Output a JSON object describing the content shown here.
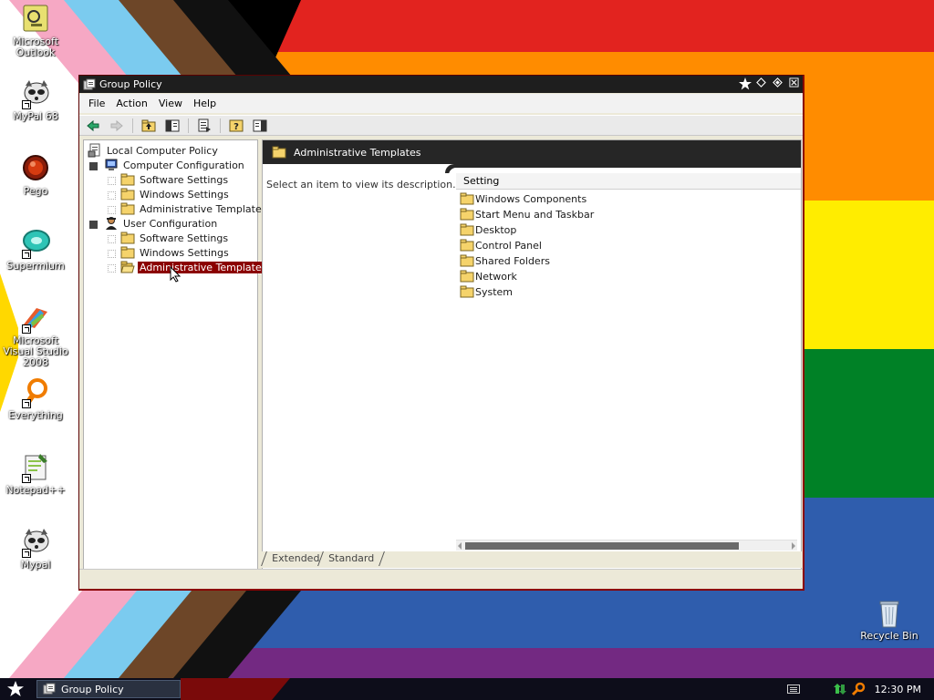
{
  "desktop": {
    "icons": [
      {
        "label": "Microsoft Outlook",
        "icon": "outlook-icon"
      },
      {
        "label": "MyPal 68",
        "icon": "mypal-icon"
      },
      {
        "label": "Pego",
        "icon": "pego-icon"
      },
      {
        "label": "Supermium",
        "icon": "supermium-icon"
      },
      {
        "label": "Microsoft Visual Studio 2008",
        "icon": "visual-studio-icon"
      },
      {
        "label": "Everything",
        "icon": "everything-icon"
      },
      {
        "label": "Notepad++",
        "icon": "notepad-plus-plus-icon"
      },
      {
        "label": "Mypal",
        "icon": "mypal-icon"
      },
      {
        "label": "Recycle Bin",
        "icon": "recycle-bin-icon"
      }
    ]
  },
  "window": {
    "title": "Group Policy",
    "menu": [
      "File",
      "Action",
      "View",
      "Help"
    ],
    "toolbar": [
      "back-icon",
      "forward-icon",
      "up-folder-icon",
      "show-hide-tree-icon",
      "export-list-icon",
      "help-icon",
      "show-hide-action-pane-icon"
    ],
    "tree": {
      "root": "Local Computer Policy",
      "computer": {
        "label": "Computer Configuration",
        "children": [
          "Software Settings",
          "Windows Settings",
          "Administrative Templates"
        ]
      },
      "user": {
        "label": "User Configuration",
        "children": [
          "Software Settings",
          "Windows Settings",
          "Administrative Templates"
        ]
      },
      "selected": "User Configuration > Administrative Templates"
    },
    "content": {
      "header": "Administrative Templates",
      "description": "Select an item to view its description.",
      "column": "Setting",
      "items": [
        "Windows Components",
        "Start Menu and Taskbar",
        "Desktop",
        "Control Panel",
        "Shared Folders",
        "Network",
        "System"
      ]
    },
    "tabs": [
      "Extended",
      "Standard"
    ]
  },
  "taskbar": {
    "task": "Group Policy",
    "clock": "12:30 PM"
  },
  "colors": {
    "selection": "#8b0000",
    "titlebar": "#1e1e1e",
    "folder": "#f5d36b"
  }
}
